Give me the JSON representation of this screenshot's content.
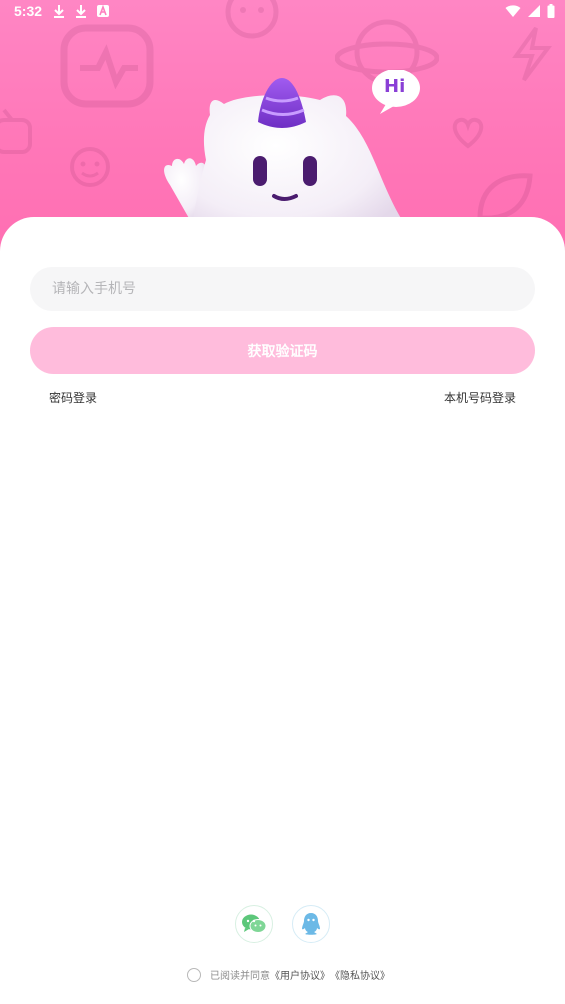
{
  "status_bar": {
    "time": "5:32",
    "left_icons": [
      "download-icon",
      "download-icon",
      "font-a-icon"
    ],
    "right_icons": [
      "wifi-icon",
      "signal-icon",
      "battery-icon"
    ]
  },
  "hero": {
    "bubble_text": "Hi",
    "colors": {
      "top": "#ff86c4",
      "bottom": "#ff6eb2",
      "mascot_hat": "#8a3fd6"
    }
  },
  "login": {
    "phone_placeholder": "请输入手机号",
    "get_code_label": "获取验证码",
    "password_login_label": "密码登录",
    "local_number_login_label": "本机号码登录",
    "button_color": "#ffbcdc"
  },
  "social": {
    "wechat_icon": "wechat-icon",
    "qq_icon": "qq-icon"
  },
  "agreement": {
    "prefix": "已阅读并同意",
    "user_agreement": "《用户协议》",
    "privacy_policy": "《隐私协议》",
    "checked": false
  }
}
